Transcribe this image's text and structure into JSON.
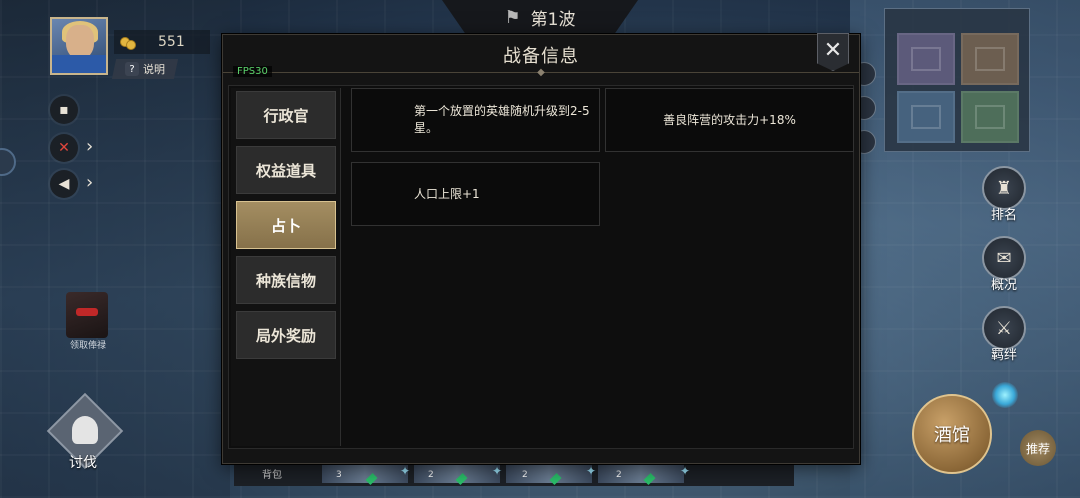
{
  "hud": {
    "gold": "551",
    "help_label": "说明",
    "wave_title": "第1波",
    "reward_label": "领取俸禄",
    "crusade_label": "讨伐",
    "bottom_label": "背包",
    "bench_numbers": [
      "3",
      "2",
      "2",
      "2"
    ]
  },
  "right_menu": {
    "rank_label": "排名",
    "overview_label": "概况",
    "bond_label": "羁绊",
    "tavern_label": "酒馆",
    "recommend_label": "推荐"
  },
  "modal": {
    "title": "战备信息",
    "fps": "FPS30",
    "tabs": [
      {
        "label": "行政官",
        "active": false
      },
      {
        "label": "权益道具",
        "active": false
      },
      {
        "label": "占卜",
        "active": true
      },
      {
        "label": "种族信物",
        "active": false
      },
      {
        "label": "局外奖励",
        "active": false
      }
    ],
    "cards": [
      {
        "text": "第一个放置的英雄随机升级到2-5星。"
      },
      {
        "text": "善良阵营的攻击力+18%"
      },
      {
        "text": "人口上限+1"
      }
    ]
  },
  "colors": {
    "modal_bg": "#141414",
    "tab_active": "#a48e62",
    "fps_green": "#5cd26c",
    "tavern_gold": "#c8a068"
  }
}
